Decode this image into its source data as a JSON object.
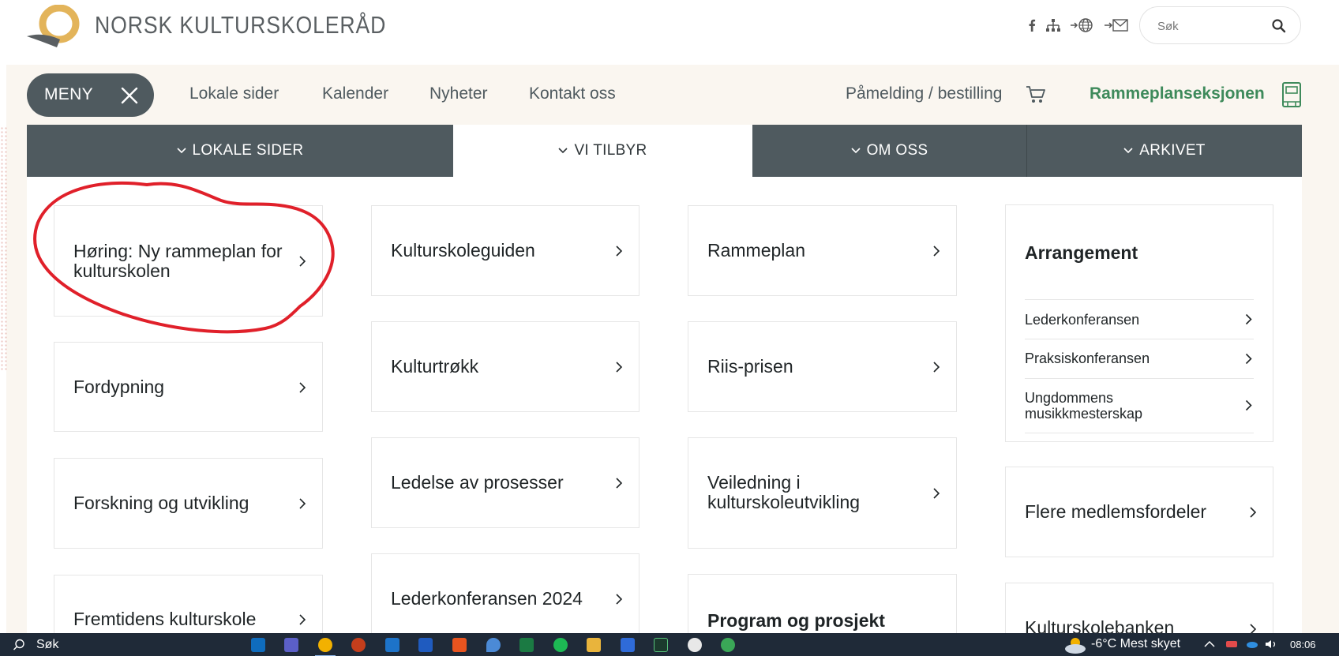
{
  "header": {
    "brand": "NORSK KULTURSKOLERÅD",
    "social_icons": [
      "facebook-icon",
      "sitemap-icon",
      "language-globe-icon",
      "newsletter-mail-icon"
    ],
    "search_placeholder": "Søk"
  },
  "nav": {
    "menu_label": "MENY",
    "links": [
      "Lokale sider",
      "Kalender",
      "Nyheter",
      "Kontakt oss"
    ],
    "order_link": "Påmelding / bestilling",
    "rammeplan_link": "Rammeplanseksjonen"
  },
  "tabs": [
    {
      "label": "LOKALE SIDER",
      "active": false
    },
    {
      "label": "VI TILBYR",
      "active": true
    },
    {
      "label": "OM OSS",
      "active": false
    },
    {
      "label": "ARKIVET",
      "active": false
    }
  ],
  "columns": {
    "col1": [
      "Høring: Ny rammeplan for kulturskolen",
      "Fordypning",
      "Forskning og utvikling",
      "Fremtidens kulturskole"
    ],
    "col2": [
      "Kulturskoleguiden",
      "Kulturtrøkk",
      "Ledelse av prosesser",
      "Lederkonferansen 2024"
    ],
    "col3": [
      "Rammeplan",
      "Riis-prisen",
      "Veiledning i kulturskoleutvikling",
      "Program og prosjekt"
    ],
    "arrangement": {
      "title": "Arrangement",
      "items": [
        "Lederkonferansen",
        "Praksiskonferansen",
        "Ungdommens musikkmesterskap"
      ]
    },
    "col4": [
      "Flere medlemsfordeler",
      "Kulturskolebanken"
    ]
  },
  "taskbar": {
    "search_label": "Søk",
    "weather": "-6°C  Mest skyet",
    "time": "08:06"
  },
  "colors": {
    "dark_slate": "#4f5a5f",
    "green_accent": "#3e8a5b",
    "beige_bg": "#faf6f0",
    "annotation_red": "#e0202a"
  }
}
